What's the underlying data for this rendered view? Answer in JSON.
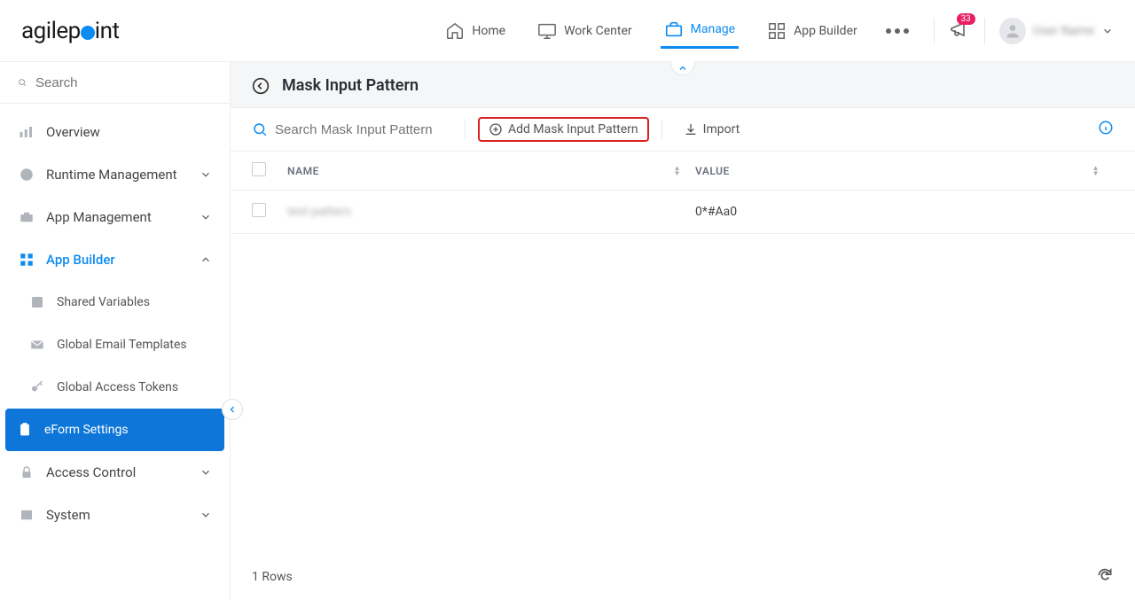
{
  "brand": {
    "part1": "agilep",
    "part2": "int"
  },
  "nav": {
    "home": "Home",
    "work_center": "Work Center",
    "manage": "Manage",
    "app_builder": "App Builder",
    "badge": "33",
    "user_name": "User Name"
  },
  "sidebar": {
    "search_placeholder": "Search",
    "items": [
      {
        "label": "Overview"
      },
      {
        "label": "Runtime Management"
      },
      {
        "label": "App Management"
      },
      {
        "label": "App Builder"
      },
      {
        "label": "Access Control"
      },
      {
        "label": "System"
      }
    ],
    "subitems": [
      {
        "label": "Shared Variables"
      },
      {
        "label": "Global Email Templates"
      },
      {
        "label": "Global Access Tokens"
      },
      {
        "label": "eForm Settings"
      }
    ]
  },
  "page": {
    "title": "Mask Input Pattern",
    "search_placeholder": "Search Mask Input Pattern",
    "add_label": "Add Mask Input Pattern",
    "import_label": "Import",
    "columns": {
      "name": "NAME",
      "value": "VALUE"
    },
    "rows": [
      {
        "name": "test pattern",
        "value": "0*#Aa0"
      }
    ],
    "footer_count": "1 Rows"
  }
}
